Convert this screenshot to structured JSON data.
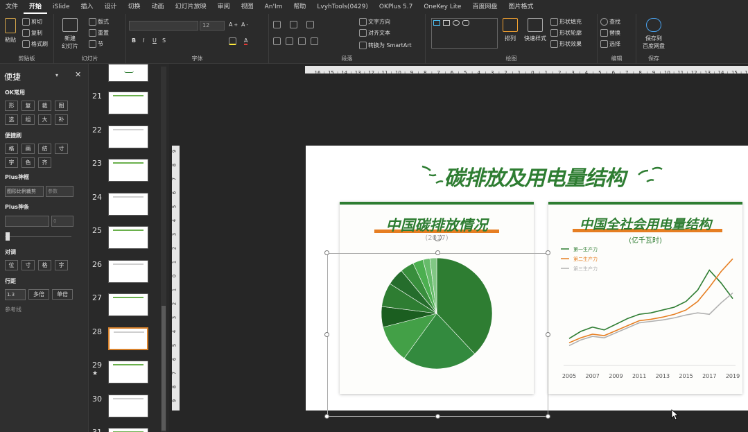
{
  "menu": {
    "tabs": [
      "文件",
      "开始",
      "iSlide",
      "插入",
      "设计",
      "切换",
      "动画",
      "幻灯片放映",
      "审阅",
      "视图",
      "An'Im",
      "帮助",
      "LvyhTools(0429)",
      "OKPlus 5.7",
      "OneKey Lite",
      "百度网盘",
      "图片格式"
    ],
    "active_index": 1
  },
  "ribbon": {
    "clipboard": {
      "label": "剪贴板",
      "paste": "粘贴",
      "cut": "剪切",
      "copy": "复制",
      "format_painter": "格式刷"
    },
    "slides": {
      "label": "幻灯片",
      "new_slide": "新建\n幻灯片",
      "layout": "版式",
      "reset": "重置",
      "section": "节"
    },
    "font": {
      "label": "字体",
      "size": "12"
    },
    "paragraph": {
      "label": "段落",
      "text_direction": "文字方向",
      "align_text": "对齐文本",
      "convert_smartart": "转换为 SmartArt"
    },
    "drawing": {
      "label": "绘图",
      "arrange": "排列",
      "quick_styles": "快速样式",
      "shape_fill": "形状填充",
      "shape_outline": "形状轮廓",
      "shape_effects": "形状效果"
    },
    "editing": {
      "label": "编辑",
      "find": "查找",
      "replace": "替换",
      "select": "选择"
    },
    "save": {
      "label": "保存",
      "save_to": "保存到\n百度网盘"
    }
  },
  "panel": {
    "title": "便捷",
    "sec_ok": "OK常用",
    "ok_buttons": [
      "形",
      "复",
      "裁",
      "图",
      "选",
      "组",
      "大",
      "补"
    ],
    "sec_brush": "便捷刷",
    "brush_buttons": [
      "格",
      "画",
      "结",
      "寸",
      "字",
      "色",
      "齐"
    ],
    "sec_plus_frame": "Plus神框",
    "crop_label": "图形比例裁剪",
    "param_placeholder": "参数",
    "sec_plus_bar": "Plus神条",
    "plus_bar_value": "0",
    "sec_adjust": "对调",
    "adjust_buttons": [
      "位",
      "寸",
      "格",
      "字"
    ],
    "sec_linespacing": "行距",
    "linespacing_value": "1.3",
    "multi_btn": "多倍",
    "single_btn": "单倍",
    "guides": "参考线"
  },
  "thumbnails": [
    {
      "num": "21",
      "star": false,
      "sel": false
    },
    {
      "num": "22",
      "star": false,
      "sel": false
    },
    {
      "num": "23",
      "star": false,
      "sel": false
    },
    {
      "num": "24",
      "star": false,
      "sel": false
    },
    {
      "num": "25",
      "star": false,
      "sel": false
    },
    {
      "num": "26",
      "star": false,
      "sel": false
    },
    {
      "num": "27",
      "star": false,
      "sel": false
    },
    {
      "num": "28",
      "star": false,
      "sel": true
    },
    {
      "num": "29",
      "star": true,
      "sel": false
    },
    {
      "num": "30",
      "star": false,
      "sel": false
    },
    {
      "num": "31",
      "star": false,
      "sel": false
    }
  ],
  "ruler": {
    "h_labels": [
      "16",
      "15",
      "14",
      "13",
      "12",
      "11",
      "10",
      "9",
      "8",
      "7",
      "6",
      "5",
      "4",
      "3",
      "2",
      "1",
      "0",
      "1",
      "2",
      "3",
      "4",
      "5",
      "6",
      "7",
      "8",
      "9",
      "10",
      "11",
      "12",
      "13",
      "14",
      "15",
      "16"
    ],
    "v_labels": [
      "9",
      "8",
      "7",
      "6",
      "5",
      "4",
      "3",
      "2",
      "1",
      "0",
      "1",
      "2",
      "3",
      "4",
      "5",
      "6",
      "7",
      "8",
      "9"
    ]
  },
  "slide": {
    "title": "碳排放及用电量结构",
    "pie_card": {
      "title": "中国碳排放情况",
      "subtitle": "(2017)"
    },
    "line_card": {
      "title": "中国全社会用电量结构",
      "subtitle": "(亿千瓦时)"
    }
  },
  "colors": {
    "accent_green": "#2e7d32",
    "orange": "#e67e22",
    "gray": "#b0b0b0",
    "selection_orange": "#d9822b"
  },
  "chart_data": [
    {
      "type": "pie",
      "title": "中国碳排放情况",
      "subtitle": "(2017)",
      "values": [
        38,
        22,
        11,
        6,
        7,
        5,
        4,
        3,
        2,
        2
      ],
      "colors": [
        "#2e7d32",
        "#338a3e",
        "#43a047",
        "#1b5e20",
        "#2e7d32",
        "#256d2c",
        "#388e3c",
        "#4caf50",
        "#66bb6a",
        "#81c784"
      ]
    },
    {
      "type": "line",
      "title": "中国全社会用电量结构",
      "subtitle": "(亿千瓦时)",
      "categories": [
        "2005",
        "2006",
        "2007",
        "2008",
        "2009",
        "2010",
        "2011",
        "2012",
        "2013",
        "2014",
        "2015",
        "2016",
        "2017",
        "2018",
        "2019"
      ],
      "x_tick_labels": [
        "2005",
        "2007",
        "2009",
        "2011",
        "2013",
        "2015",
        "2017",
        "2019"
      ],
      "series": [
        {
          "name": "第一生产力",
          "color": "#2e7d32",
          "values": [
            32,
            42,
            48,
            44,
            52,
            60,
            66,
            68,
            72,
            76,
            84,
            100,
            128,
            110,
            88
          ]
        },
        {
          "name": "第二生产力",
          "color": "#e67e22",
          "values": [
            26,
            33,
            38,
            36,
            43,
            50,
            57,
            59,
            62,
            66,
            72,
            84,
            104,
            126,
            144
          ]
        },
        {
          "name": "第三生产力",
          "color": "#b0b0b0",
          "values": [
            22,
            30,
            35,
            33,
            40,
            47,
            54,
            56,
            58,
            61,
            65,
            68,
            66,
            82,
            96
          ]
        }
      ],
      "legend_position": "top-left",
      "grid": false
    }
  ]
}
